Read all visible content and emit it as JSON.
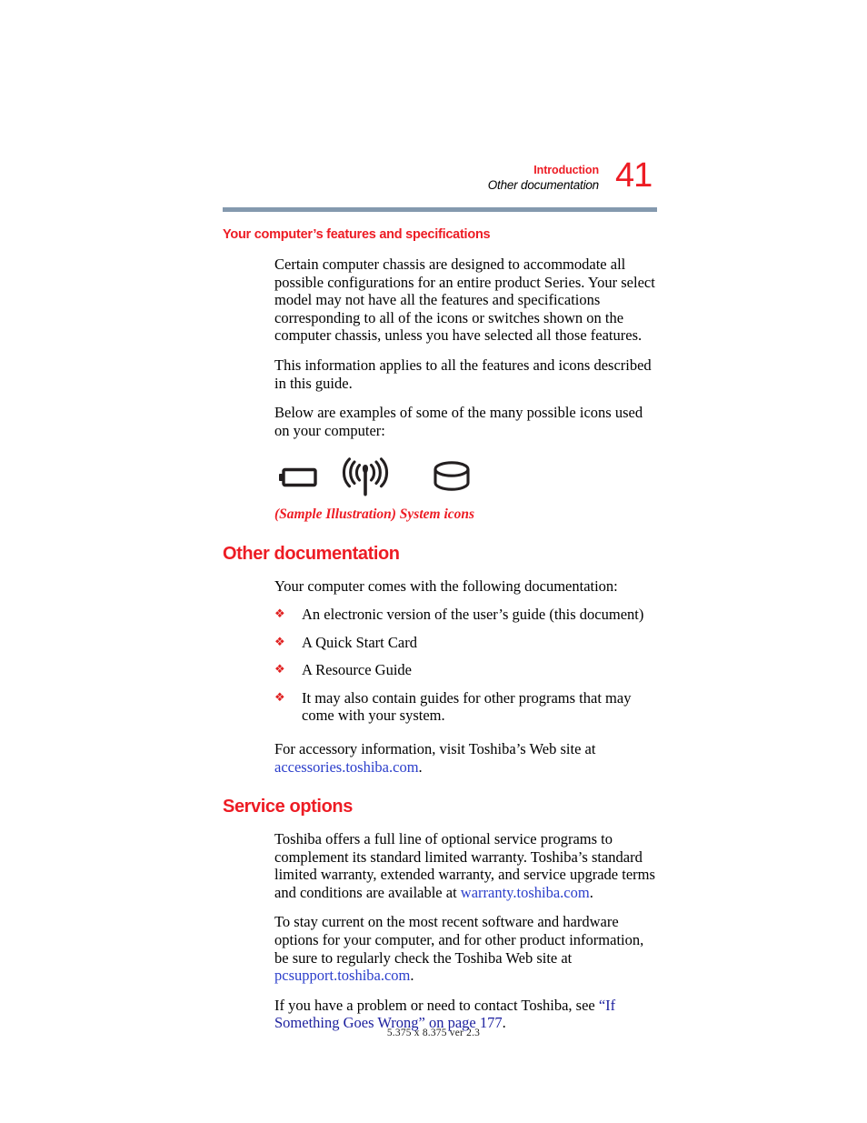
{
  "header": {
    "chapter": "Introduction",
    "section": "Other documentation",
    "page_number": "41",
    "rule_color": "#8499ae"
  },
  "colors": {
    "heading_red": "#ed1c24",
    "link_blue": "#2b3ecb",
    "xref_blue": "#1b1f9e",
    "bullet_red": "#e02020"
  },
  "sections": [
    {
      "id": "features",
      "level": 2,
      "heading": "Your computer’s features and specifications",
      "paragraphs": [
        "Certain computer chassis are designed to accommodate all possible configurations for an entire product Series. Your select model may not have all the features and specifications corresponding to all of the icons or switches shown on the computer chassis, unless you have selected all those features.",
        "This information applies to all the features and icons described in this guide.",
        "Below are examples of some of the many possible icons used on your computer:"
      ],
      "icons": [
        {
          "name": "battery-icon",
          "label": "Battery"
        },
        {
          "name": "wireless-antenna-icon",
          "label": "Wireless antenna"
        },
        {
          "name": "disk-drive-icon",
          "label": "Disk drive"
        }
      ],
      "caption": "(Sample Illustration) System icons"
    },
    {
      "id": "other-documentation",
      "level": 1,
      "heading": "Other documentation",
      "intro": "Your computer comes with the following documentation:",
      "bullet_glyph": "❖",
      "bullets": [
        "An electronic version of the user’s guide (this document)",
        "A Quick Start Card",
        "A Resource Guide",
        "It may also contain guides for other programs that may come with your system."
      ],
      "closing": {
        "before": "For accessory information, visit Toshiba’s Web site at ",
        "link": "accessories.toshiba.com",
        "after": "."
      }
    },
    {
      "id": "service-options",
      "level": 1,
      "heading": "Service options",
      "paragraph_1": {
        "before": "Toshiba offers a full line of optional service programs to complement its standard limited warranty. Toshiba’s standard limited warranty, extended warranty, and service upgrade terms and conditions are available at ",
        "link": "warranty.toshiba.com",
        "after": "."
      },
      "paragraph_2": {
        "before": "To stay current on the most recent software and hardware options for your computer, and for other product information, be sure to regularly check the Toshiba Web site at ",
        "link": "pcsupport.toshiba.com",
        "after": "."
      },
      "paragraph_3": {
        "before": "If you have a problem or need to contact Toshiba, see ",
        "link": "“If Something Goes Wrong” on page 177",
        "after": "."
      }
    }
  ],
  "footer": {
    "text": "5.375 x 8.375 ver 2.3"
  }
}
